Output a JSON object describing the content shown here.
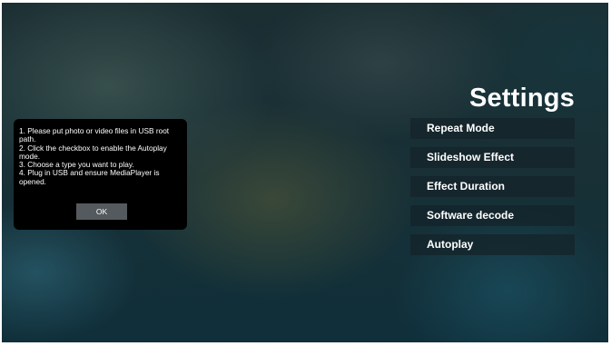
{
  "page": {
    "title": "Settings"
  },
  "menu": {
    "items": [
      {
        "label": "Repeat Mode"
      },
      {
        "label": "Slideshow Effect"
      },
      {
        "label": "Effect Duration"
      },
      {
        "label": "Software decode"
      },
      {
        "label": "Autoplay"
      }
    ]
  },
  "dialog": {
    "lines": [
      "1. Please put photo or video files in USB root",
      "path.",
      "2. Click the checkbox to enable the Autoplay",
      "mode.",
      "3. Choose a type you want to play.",
      "4. Plug in USB and ensure MediaPlayer is",
      "opened."
    ],
    "ok_label": "OK"
  },
  "colors": {
    "menu_item_bg": "#14242a",
    "dialog_bg": "#000000",
    "ok_button_bg": "#555a5e",
    "text": "#ffffff"
  }
}
